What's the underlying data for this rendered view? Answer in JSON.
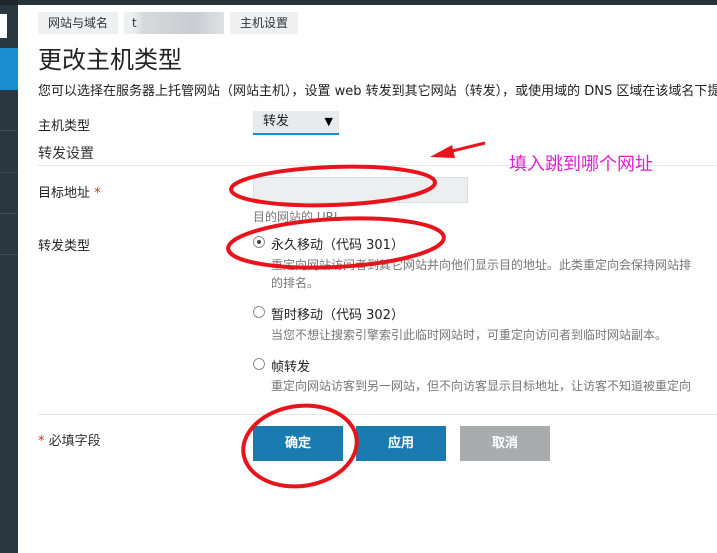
{
  "breadcrumb": {
    "items": [
      "网站与域名",
      "t",
      "主机设置"
    ]
  },
  "page": {
    "title": "更改主机类型",
    "description": "您可以选择在服务器上托管网站（网站主机），设置 web 转发到其它网站（转发），或使用域的 DNS 区域在该域名下提供"
  },
  "form": {
    "host_type_label": "主机类型",
    "host_type_value": "转发",
    "host_type_caret": "▼",
    "section_title": "转发设置",
    "target_label": "目标地址",
    "required_star": "*",
    "target_value": "",
    "target_hint": "目的网站的 URL",
    "redirect_type_label": "转发类型",
    "options": [
      {
        "label": "永久移动（代码 301）",
        "desc": "重定向网站访问者到其它网站并向他们显示目的地址。此类重定向会保持网站排",
        "desc2": "的排名。",
        "checked": true
      },
      {
        "label": "暂时移动（代码 302）",
        "desc": "当您不想让搜索引擎索引此临时网站时，可重定向访问者到临时网站副本。",
        "checked": false
      },
      {
        "label": "帧转发",
        "desc": "重定向网站访客到另一网站，但不向访客显示目标地址，让访客不知道被重定向",
        "checked": false
      }
    ],
    "required_note": "必填字段"
  },
  "buttons": {
    "ok": "确定",
    "apply": "应用",
    "cancel": "取消"
  },
  "annotation": {
    "text": "填入跳到哪个网址",
    "color": "#e020d0",
    "circle_color": "#e8141c"
  },
  "colors": {
    "accent": "#1a7bb0",
    "sidebar": "#2b3740",
    "sidebar_active": "#1a8ed1"
  }
}
